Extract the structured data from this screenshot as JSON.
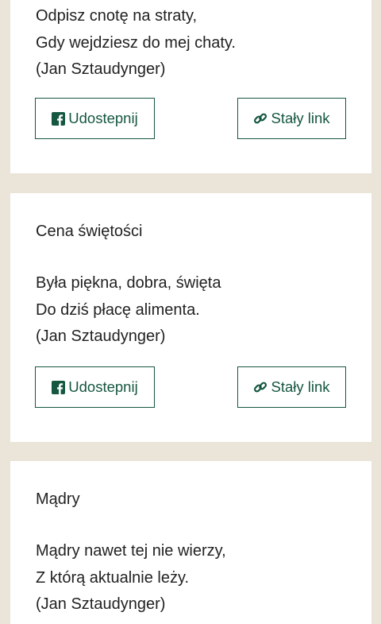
{
  "posts": [
    {
      "title": "",
      "lines": [
        "Odpisz cnotę na straty,",
        "Gdy wejdziesz do mej chaty.",
        "(Jan Sztaudynger)"
      ],
      "share_label": "Udostepnij",
      "link_label": "Stały link"
    },
    {
      "title": "Cena świętości",
      "lines": [
        "Była piękna, dobra, święta",
        "Do dziś płacę alimenta.",
        "(Jan Sztaudynger)"
      ],
      "share_label": "Udostepnij",
      "link_label": "Stały link"
    },
    {
      "title": "Mądry",
      "lines": [
        "Mądry nawet tej nie wierzy,",
        "Z którą aktualnie leży.",
        "(Jan Sztaudynger)"
      ]
    }
  ],
  "icons": {
    "share": "facebook-icon",
    "link": "link-icon"
  },
  "colors": {
    "page_background": "#ebe4d9",
    "card_background": "#ffffff",
    "accent": "#15573f",
    "text": "#222222"
  }
}
